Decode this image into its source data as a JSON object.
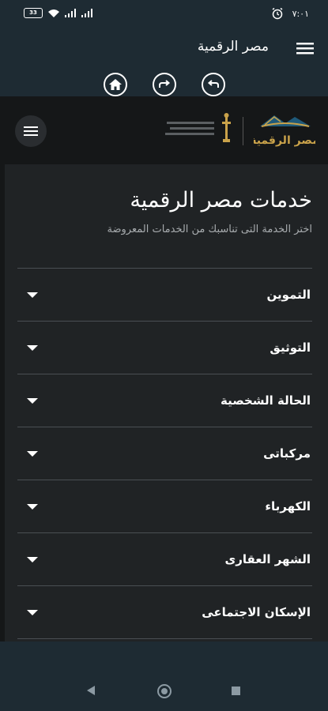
{
  "status_bar": {
    "time": "٧:٠١",
    "battery": "33"
  },
  "app_bar": {
    "title": "مصر الرقمية"
  },
  "site": {
    "logo_text": "مصر الرقمية"
  },
  "content": {
    "title": "خدمات مصر الرقمية",
    "subtitle": "اختر الخدمة التى تناسبك من الخدمات المعروضة"
  },
  "services": [
    {
      "label": "التموين"
    },
    {
      "label": "التوثيق"
    },
    {
      "label": "الحالة الشخصية"
    },
    {
      "label": "مركباتى"
    },
    {
      "label": "الكهرباء"
    },
    {
      "label": "الشهر العقارى"
    },
    {
      "label": "الإسكان الاجتماعى"
    }
  ],
  "icons": {
    "menu": "hamburger-icon",
    "home": "home-icon",
    "forward": "forward-icon",
    "back": "back-icon"
  },
  "colors": {
    "app_bg": "#1e2b33",
    "page_bg": "#202325",
    "header_bg": "#151718",
    "divider": "#4a4f53",
    "logo_gold": "#c9a24a",
    "logo_blue": "#1f5a7a"
  }
}
